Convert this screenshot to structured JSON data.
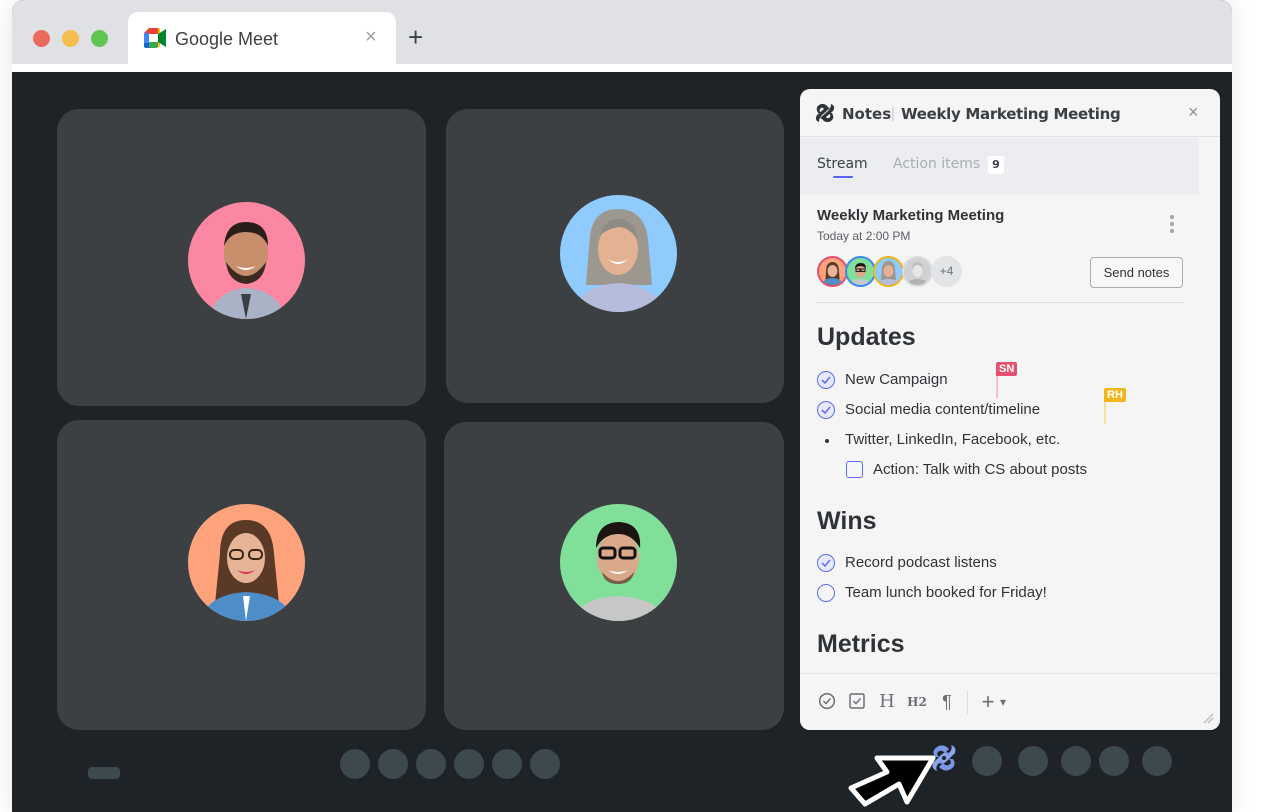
{
  "browser": {
    "tab_title": "Google Meet",
    "tab_close": "×",
    "new_tab": "+"
  },
  "meet": {
    "participants": [
      {
        "name": "participant-1",
        "bg_color": "#fb87a3"
      },
      {
        "name": "participant-2",
        "bg_color": "#8fcbfd"
      },
      {
        "name": "participant-3",
        "bg_color": "#fea37b"
      },
      {
        "name": "participant-4",
        "bg_color": "#80df98"
      }
    ]
  },
  "notes": {
    "app_label": "Notes",
    "separator": "|",
    "meeting_name": "Weekly Marketing Meeting",
    "close": "×",
    "tabs": [
      {
        "label": "Stream",
        "active": true
      },
      {
        "label": "Action items",
        "badge": "9",
        "active": false
      }
    ],
    "meeting": {
      "title": "Weekly Marketing Meeting",
      "time": "Today at 2:00 PM",
      "attendees_more": "+4",
      "send_label": "Send notes"
    },
    "sections": {
      "updates": {
        "heading": "Updates",
        "items": [
          {
            "text": "New Campaign",
            "type": "check-circle",
            "done": true
          },
          {
            "text": "Social media content/timeline",
            "type": "check-circle",
            "done": true
          },
          {
            "text": "Twitter, LinkedIn, Facebook, etc.",
            "type": "bullet"
          },
          {
            "text": "Action: Talk with CS about posts",
            "type": "checkbox",
            "done": false
          }
        ]
      },
      "wins": {
        "heading": "Wins",
        "items": [
          {
            "text": "Record podcast listens",
            "type": "check-circle",
            "done": true
          },
          {
            "text": "Team lunch booked for Friday!",
            "type": "check-circle",
            "done": false
          }
        ]
      },
      "metrics": {
        "heading": "Metrics"
      }
    },
    "collaborators": [
      {
        "initials": "SN",
        "color": "#e5506e"
      },
      {
        "initials": "RH",
        "color": "#f2b51d"
      }
    ],
    "toolbar": {
      "h1": "H",
      "h2": "H2",
      "paragraph": "¶",
      "add": "+",
      "add_caret": "▾"
    }
  },
  "colors": {
    "accent": "#5b6cf0",
    "stage_bg": "#1d2326",
    "tile_bg": "#3c4043"
  }
}
